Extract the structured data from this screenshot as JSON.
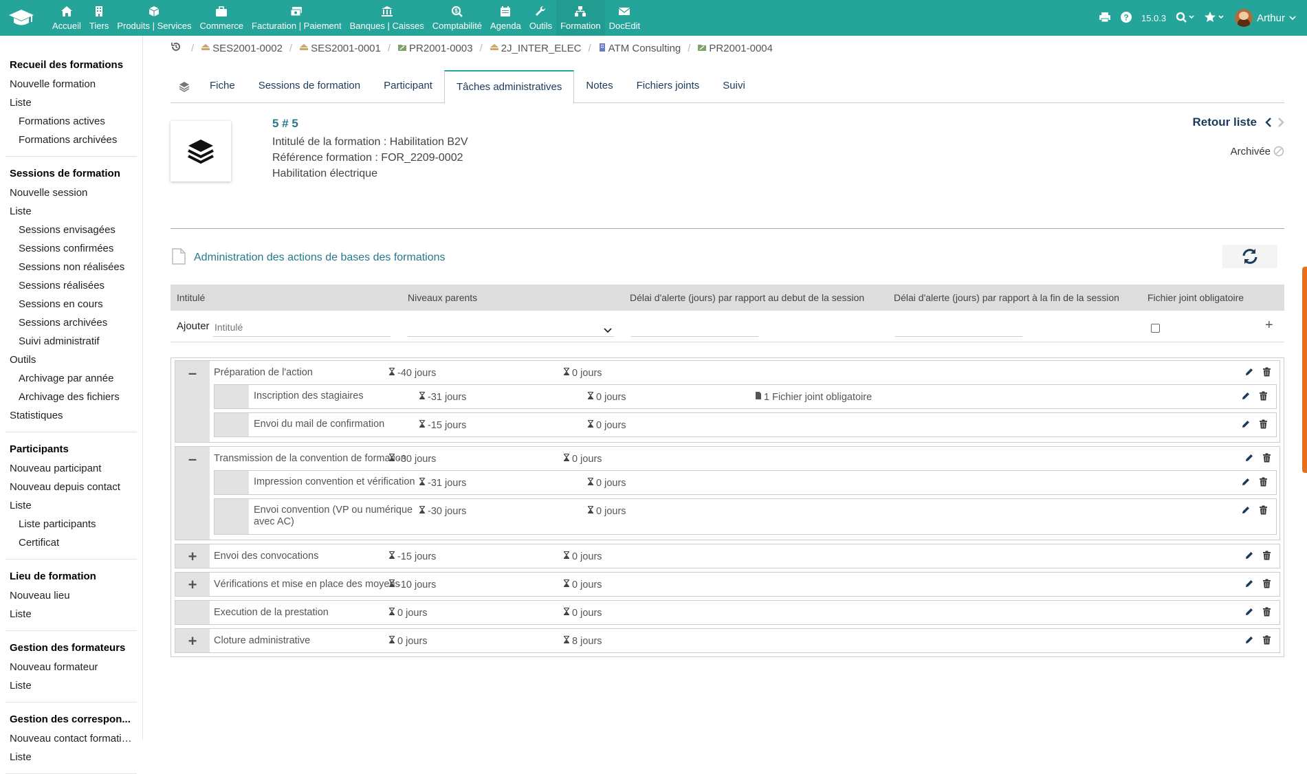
{
  "topbar": {
    "menu": [
      {
        "label": "Accueil",
        "icon": "home-icon"
      },
      {
        "label": "Tiers",
        "icon": "building-icon"
      },
      {
        "label": "Produits | Services",
        "icon": "cube-icon"
      },
      {
        "label": "Commerce",
        "icon": "briefcase-icon"
      },
      {
        "label": "Facturation | Paiement",
        "icon": "money-icon"
      },
      {
        "label": "Banques | Caisses",
        "icon": "bank-icon"
      },
      {
        "label": "Comptabilité",
        "icon": "search-dollar-icon"
      },
      {
        "label": "Agenda",
        "icon": "calendar-icon"
      },
      {
        "label": "Outils",
        "icon": "wrench-icon"
      },
      {
        "label": "Formation",
        "icon": "sitemap-icon"
      },
      {
        "label": "DocEdit",
        "icon": "envelope-icon"
      }
    ],
    "active_menu": "Formation",
    "version": "15.0.3",
    "user": "Arthur"
  },
  "sidebar": [
    {
      "title": "Recueil des formations",
      "items": [
        {
          "label": "Nouvelle formation",
          "sub": false
        },
        {
          "label": "Liste",
          "sub": false
        },
        {
          "label": "Formations actives",
          "sub": true
        },
        {
          "label": "Formations archivées",
          "sub": true
        }
      ]
    },
    {
      "title": "Sessions de formation",
      "items": [
        {
          "label": "Nouvelle session",
          "sub": false
        },
        {
          "label": "Liste",
          "sub": false
        },
        {
          "label": "Sessions envisagées",
          "sub": true
        },
        {
          "label": "Sessions confirmées",
          "sub": true
        },
        {
          "label": "Sessions non réalisées",
          "sub": true
        },
        {
          "label": "Sessions réalisées",
          "sub": true
        },
        {
          "label": "Sessions en cours",
          "sub": true
        },
        {
          "label": "Sessions archivées",
          "sub": true
        },
        {
          "label": "Suivi administratif",
          "sub": true
        },
        {
          "label": "Outils",
          "sub": false
        },
        {
          "label": "Archivage par année",
          "sub": true
        },
        {
          "label": "Archivage des fichiers",
          "sub": true
        },
        {
          "label": "Statistiques",
          "sub": false
        }
      ]
    },
    {
      "title": "Participants",
      "items": [
        {
          "label": "Nouveau participant",
          "sub": false
        },
        {
          "label": "Nouveau depuis contact",
          "sub": false
        },
        {
          "label": "Liste",
          "sub": false
        },
        {
          "label": "Liste participants",
          "sub": true
        },
        {
          "label": "Certificat",
          "sub": true
        }
      ]
    },
    {
      "title": "Lieu de formation",
      "items": [
        {
          "label": "Nouveau lieu",
          "sub": false
        },
        {
          "label": "Liste",
          "sub": false
        }
      ]
    },
    {
      "title": "Gestion des formateurs",
      "items": [
        {
          "label": "Nouveau formateur",
          "sub": false
        },
        {
          "label": "Liste",
          "sub": false
        }
      ]
    },
    {
      "title": "Gestion des correspon...",
      "items": [
        {
          "label": "Nouveau contact formation",
          "sub": false
        },
        {
          "label": "Liste",
          "sub": false
        }
      ]
    }
  ],
  "breadcrumbs": [
    "SES2001-0002",
    "SES2001-0001",
    "PR2001-0003",
    "2J_INTER_ELEC",
    "ATM Consulting",
    "PR2001-0004"
  ],
  "tabs": [
    "Fiche",
    "Sessions de formation",
    "Participant",
    "Tâches administratives",
    "Notes",
    "Fichiers joints",
    "Suivi"
  ],
  "active_tab": "Tâches administratives",
  "record": {
    "ref": "5 # 5",
    "line1": "Intitulé de la formation : Habilitation B2V",
    "line2": "Référence formation : FOR_2209-0002",
    "line3": "Habilitation électrique",
    "back_label": "Retour liste",
    "status": "Archivée"
  },
  "admin": {
    "title": "Administration des actions de bases des formations",
    "columns": [
      "Intitulé",
      "Niveaux parents",
      "Délai d'alerte (jours) par rapport au debut de la session",
      "Délai d'alerte (jours) par rapport à la fin de la session",
      "Fichier joint obligatoire"
    ],
    "add_label": "Ajouter",
    "add_placeholder": "Intitulé"
  },
  "tasks": [
    {
      "label": "Préparation de l'action",
      "start": "-40 jours",
      "end": "0 jours",
      "toggle": "minus",
      "children": [
        {
          "label": "Inscription des stagiaires",
          "start": "-31 jours",
          "end": "0 jours",
          "file": "1 Fichier joint obligatoire"
        },
        {
          "label": "Envoi du mail de confirmation",
          "start": "-15 jours",
          "end": "0 jours",
          "file": ""
        }
      ]
    },
    {
      "label": "Transmission de la convention de formation",
      "start": "-30 jours",
      "end": "0 jours",
      "toggle": "minus",
      "children": [
        {
          "label": "Impression convention et vérification",
          "start": "-31 jours",
          "end": "0 jours",
          "file": ""
        },
        {
          "label": "Envoi convention (VP ou numérique avec AC)",
          "start": "-30 jours",
          "end": "0 jours",
          "file": ""
        }
      ]
    },
    {
      "label": "Envoi des convocations",
      "start": "-15 jours",
      "end": "0 jours",
      "toggle": "plus",
      "children": []
    },
    {
      "label": "Vérifications et mise en place des moyens",
      "start": "-10 jours",
      "end": "0 jours",
      "toggle": "plus",
      "children": []
    },
    {
      "label": "Execution de la prestation",
      "start": "0 jours",
      "end": "0 jours",
      "toggle": "none",
      "children": []
    },
    {
      "label": "Cloture administrative",
      "start": "0 jours",
      "end": "8 jours",
      "toggle": "plus",
      "children": []
    }
  ]
}
